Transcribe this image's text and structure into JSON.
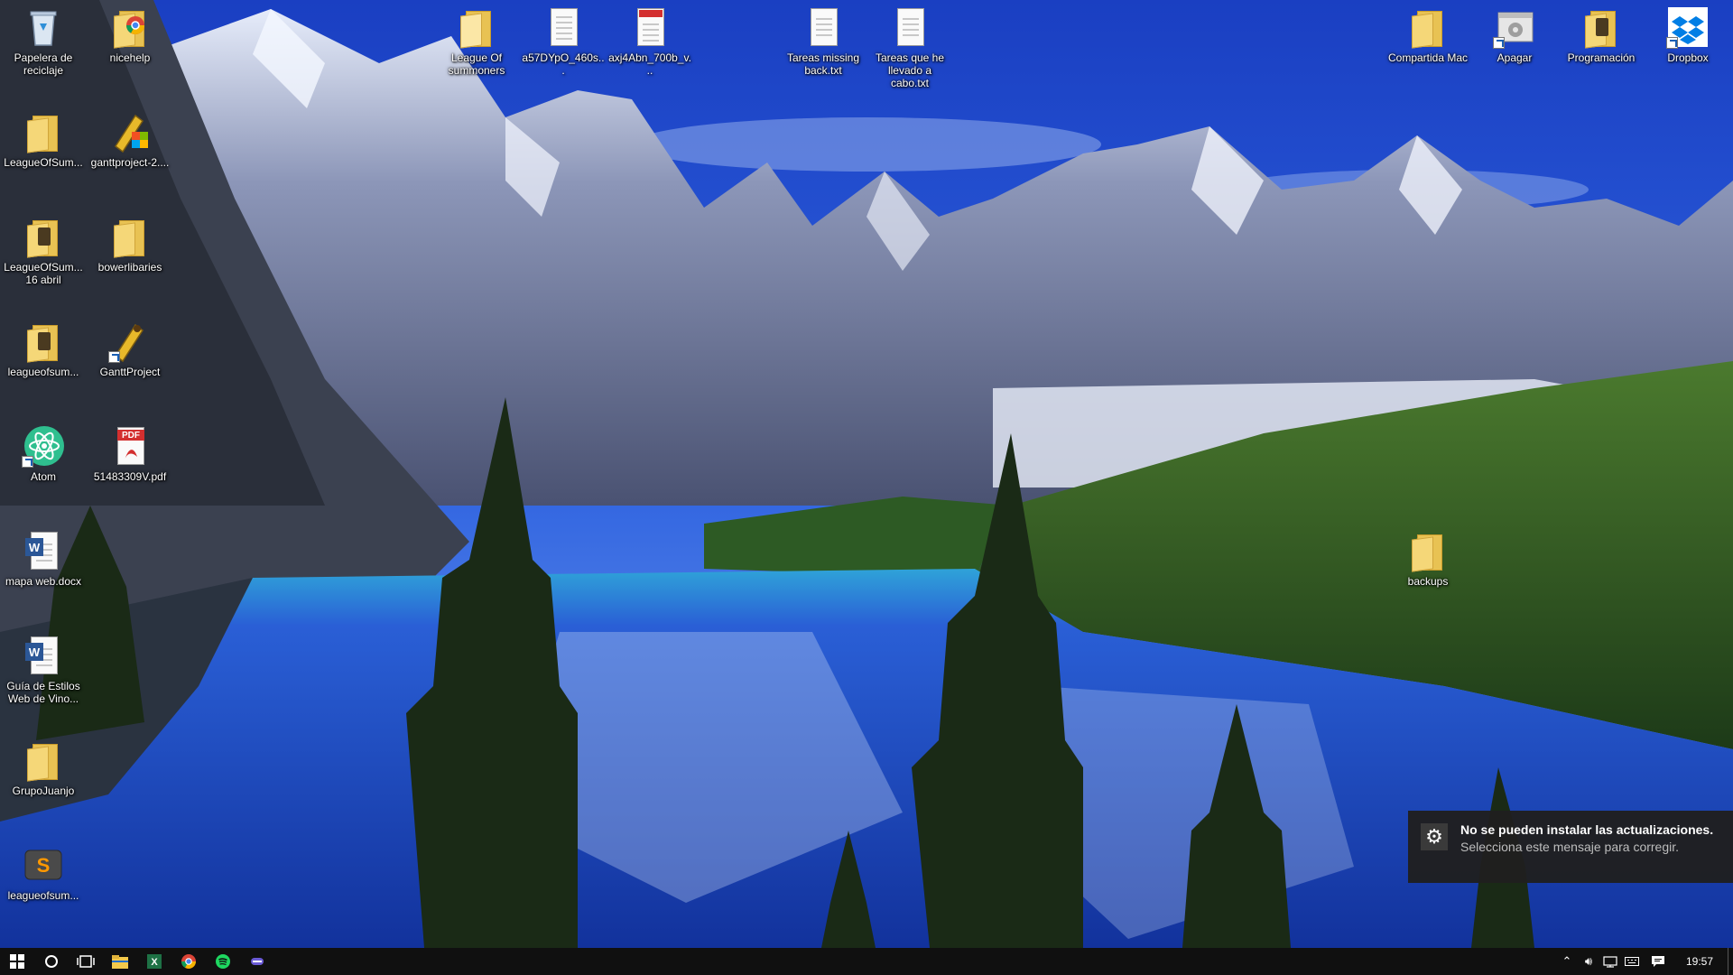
{
  "desktop": {
    "icons": [
      {
        "id": "recycle-bin",
        "label": "Papelera de reciclaje"
      },
      {
        "id": "nicehelp",
        "label": "nicehelp"
      },
      {
        "id": "league-of-summoners",
        "label": "League Of summoners"
      },
      {
        "id": "a57dypo",
        "label": "a57DYpO_460s..."
      },
      {
        "id": "axj4abn",
        "label": "axj4Abn_700b_v..."
      },
      {
        "id": "tareas-missing",
        "label": "Tareas missing back.txt"
      },
      {
        "id": "tareas-que-he",
        "label": "Tareas que he llevado a cabo.txt"
      },
      {
        "id": "compartida-mac",
        "label": "Compartida Mac"
      },
      {
        "id": "apagar",
        "label": "Apagar"
      },
      {
        "id": "programacion",
        "label": "Programación"
      },
      {
        "id": "dropbox",
        "label": "Dropbox"
      },
      {
        "id": "leagueofsum-1",
        "label": "LeagueOfSum..."
      },
      {
        "id": "ganttproject-2",
        "label": "ganttproject-2...."
      },
      {
        "id": "leagueofsum-16abril",
        "label": "LeagueOfSum... 16 abril"
      },
      {
        "id": "bowerlibaries",
        "label": "bowerlibaries"
      },
      {
        "id": "leagueofsum-2",
        "label": "leagueofsum..."
      },
      {
        "id": "ganttproject",
        "label": "GanttProject"
      },
      {
        "id": "atom",
        "label": "Atom"
      },
      {
        "id": "pdf-51483309v",
        "label": "51483309V.pdf"
      },
      {
        "id": "mapa-web",
        "label": "mapa web.docx"
      },
      {
        "id": "guia-estilos",
        "label": "Guía de Estilos Web de Vino..."
      },
      {
        "id": "grupojuanjo",
        "label": "GrupoJuanjo"
      },
      {
        "id": "leagueofsum-3",
        "label": "leagueofsum..."
      },
      {
        "id": "backups",
        "label": "backups"
      }
    ]
  },
  "notification": {
    "title": "No se pueden instalar las actualizaciones.",
    "body": "Selecciona este mensaje para corregir."
  },
  "taskbar": {
    "clock": "19:57",
    "pinned": [
      "start",
      "search",
      "task-view",
      "file-explorer",
      "excel",
      "chrome",
      "spotify",
      "app"
    ]
  },
  "colors": {
    "taskbar": "#101010",
    "toast": "#1f1f1f",
    "folder": "#f5d778",
    "sky": "#1e49c9",
    "lake": "#1f4fd6"
  }
}
